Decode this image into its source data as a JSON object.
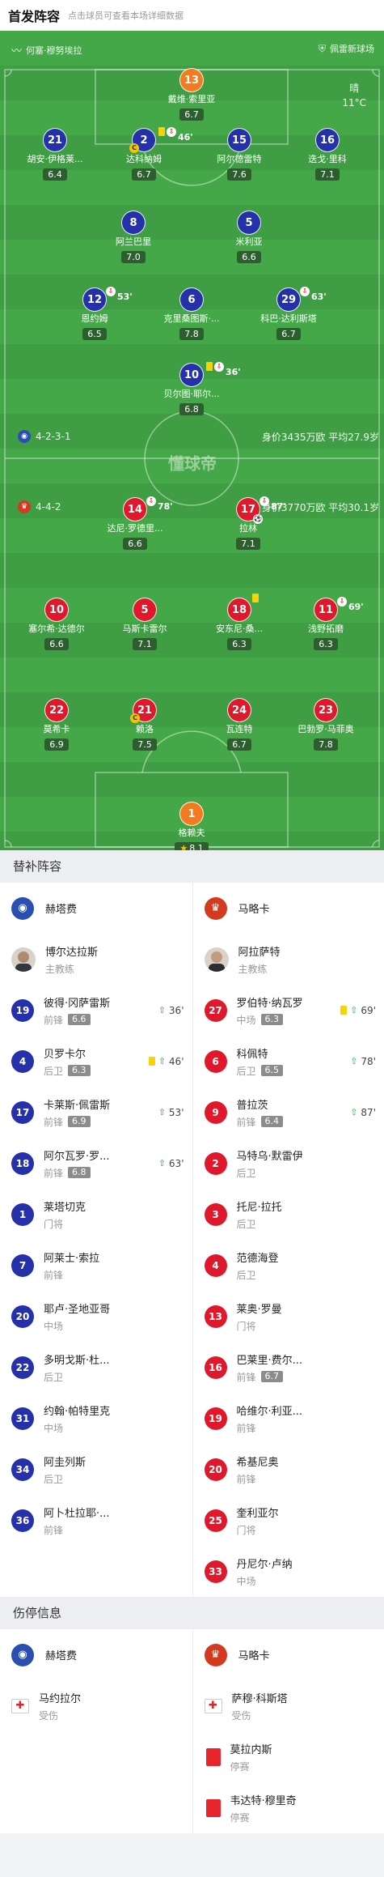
{
  "header": {
    "title": "首发阵容",
    "subtitle": "点击球员可查看本场详细数据"
  },
  "venue": {
    "home_coach": "何塞·穆努埃拉",
    "stadium": "佩雷新球场"
  },
  "weather": {
    "condition": "晴",
    "temperature": "11°C"
  },
  "watermark": "懂球帝",
  "home_team": {
    "name": "赫塔费",
    "formation": "4-2-3-1",
    "value_text": "身价3435万欧 平均27.9岁",
    "color": "#2431a8",
    "players": [
      {
        "num": "13",
        "name": "戴维·索里亚",
        "rating": "6.7",
        "gk": true
      },
      {
        "num": "21",
        "name": "胡安·伊格莱...",
        "rating": "6.4"
      },
      {
        "num": "2",
        "name": "达科纳姆",
        "rating": "6.7",
        "captain": "C",
        "card_min": "46'"
      },
      {
        "num": "15",
        "name": "阿尔德雷特",
        "rating": "7.6"
      },
      {
        "num": "16",
        "name": "迭戈·里科",
        "rating": "7.1"
      },
      {
        "num": "8",
        "name": "阿兰巴里",
        "rating": "7.0"
      },
      {
        "num": "5",
        "name": "米利亚",
        "rating": "6.6"
      },
      {
        "num": "12",
        "name": "恩约姆",
        "rating": "6.5",
        "sub_min": "53'"
      },
      {
        "num": "6",
        "name": "克里桑图斯·...",
        "rating": "7.8"
      },
      {
        "num": "29",
        "name": "科巴·达利斯塔",
        "rating": "6.7",
        "sub_min": "63'"
      },
      {
        "num": "10",
        "name": "贝尔图·耶尔...",
        "rating": "6.8",
        "sub_min": "36'"
      }
    ]
  },
  "away_team": {
    "name": "马略卡",
    "formation": "4-4-2",
    "value_text": "身价3770万欧 平均30.1岁",
    "color": "#e0182b",
    "players": [
      {
        "num": "14",
        "name": "达尼·罗德里...",
        "rating": "6.6",
        "sub_min": "78'"
      },
      {
        "num": "17",
        "name": "拉林",
        "rating": "7.1",
        "sub_min": "87'"
      },
      {
        "num": "10",
        "name": "塞尔希·达德尔",
        "rating": "6.6"
      },
      {
        "num": "5",
        "name": "马斯卡雷尔",
        "rating": "7.1"
      },
      {
        "num": "18",
        "name": "安东尼·桑...",
        "rating": "6.3"
      },
      {
        "num": "11",
        "name": "浅野拓磨",
        "rating": "6.3",
        "sub_min": "69'"
      },
      {
        "num": "22",
        "name": "莫希卡",
        "rating": "6.9"
      },
      {
        "num": "21",
        "name": "赖洛",
        "rating": "7.5",
        "captain": "C"
      },
      {
        "num": "24",
        "name": "瓦连特",
        "rating": "6.7"
      },
      {
        "num": "23",
        "name": "巴勃罗·马菲奥",
        "rating": "7.8"
      },
      {
        "num": "1",
        "name": "格赖夫",
        "rating": "8.1",
        "gk": true,
        "mvp": "★"
      }
    ]
  },
  "subs": {
    "title": "替补阵容",
    "home": {
      "team": "赫塔费",
      "coach": "博尔达拉斯",
      "coach_role": "主教练",
      "players": [
        {
          "num": "19",
          "name": "彼得·冈萨雷斯",
          "pos": "前锋",
          "rating": "6.6",
          "min": "36'"
        },
        {
          "num": "4",
          "name": "贝罗卡尔",
          "pos": "后卫",
          "rating": "6.3",
          "min": "46'",
          "yellow": true
        },
        {
          "num": "17",
          "name": "卡莱斯·佩雷斯",
          "pos": "前锋",
          "rating": "6.9",
          "min": "53'"
        },
        {
          "num": "18",
          "name": "阿尔瓦罗·罗...",
          "pos": "前锋",
          "rating": "6.8",
          "min": "63'"
        },
        {
          "num": "1",
          "name": "莱塔切克",
          "pos": "门将"
        },
        {
          "num": "7",
          "name": "阿莱士·索拉",
          "pos": "前锋"
        },
        {
          "num": "20",
          "name": "耶卢·圣地亚哥",
          "pos": "中场"
        },
        {
          "num": "22",
          "name": "多明戈斯·杜...",
          "pos": "后卫"
        },
        {
          "num": "31",
          "name": "约翰·帕特里克",
          "pos": "中场"
        },
        {
          "num": "34",
          "name": "阿圭列斯",
          "pos": "后卫"
        },
        {
          "num": "36",
          "name": "阿卜杜拉耶·...",
          "pos": "前锋"
        }
      ]
    },
    "away": {
      "team": "马略卡",
      "coach": "阿拉萨特",
      "coach_role": "主教练",
      "players": [
        {
          "num": "27",
          "name": "罗伯特·纳瓦罗",
          "pos": "中场",
          "rating": "6.3",
          "min": "69'",
          "yellow": true
        },
        {
          "num": "6",
          "name": "科佩特",
          "pos": "后卫",
          "rating": "6.5",
          "min": "78'"
        },
        {
          "num": "9",
          "name": "普拉茨",
          "pos": "前锋",
          "rating": "6.4",
          "min": "87'"
        },
        {
          "num": "2",
          "name": "马特乌·默雷伊",
          "pos": "后卫"
        },
        {
          "num": "3",
          "name": "托尼·拉托",
          "pos": "后卫"
        },
        {
          "num": "4",
          "name": "范德海登",
          "pos": "后卫"
        },
        {
          "num": "13",
          "name": "莱奥·罗曼",
          "pos": "门将"
        },
        {
          "num": "16",
          "name": "巴莱里·费尔...",
          "pos": "前锋",
          "rating": "6.7"
        },
        {
          "num": "19",
          "name": "哈维尔·利亚...",
          "pos": "前锋"
        },
        {
          "num": "20",
          "name": "希基尼奥",
          "pos": "前锋"
        },
        {
          "num": "25",
          "name": "奎利亚尔",
          "pos": "门将"
        },
        {
          "num": "33",
          "name": "丹尼尔·卢纳",
          "pos": "中场"
        }
      ]
    }
  },
  "injuries": {
    "title": "伤停信息",
    "home": {
      "team": "赫塔费",
      "players": [
        {
          "name": "马约拉尔",
          "status": "受伤",
          "type": "injury"
        }
      ]
    },
    "away": {
      "team": "马略卡",
      "players": [
        {
          "name": "萨穆·科斯塔",
          "status": "受伤",
          "type": "injury"
        },
        {
          "name": "莫拉内斯",
          "status": "停赛",
          "type": "suspension"
        },
        {
          "name": "韦达特·穆里奇",
          "status": "停赛",
          "type": "suspension"
        }
      ]
    }
  }
}
